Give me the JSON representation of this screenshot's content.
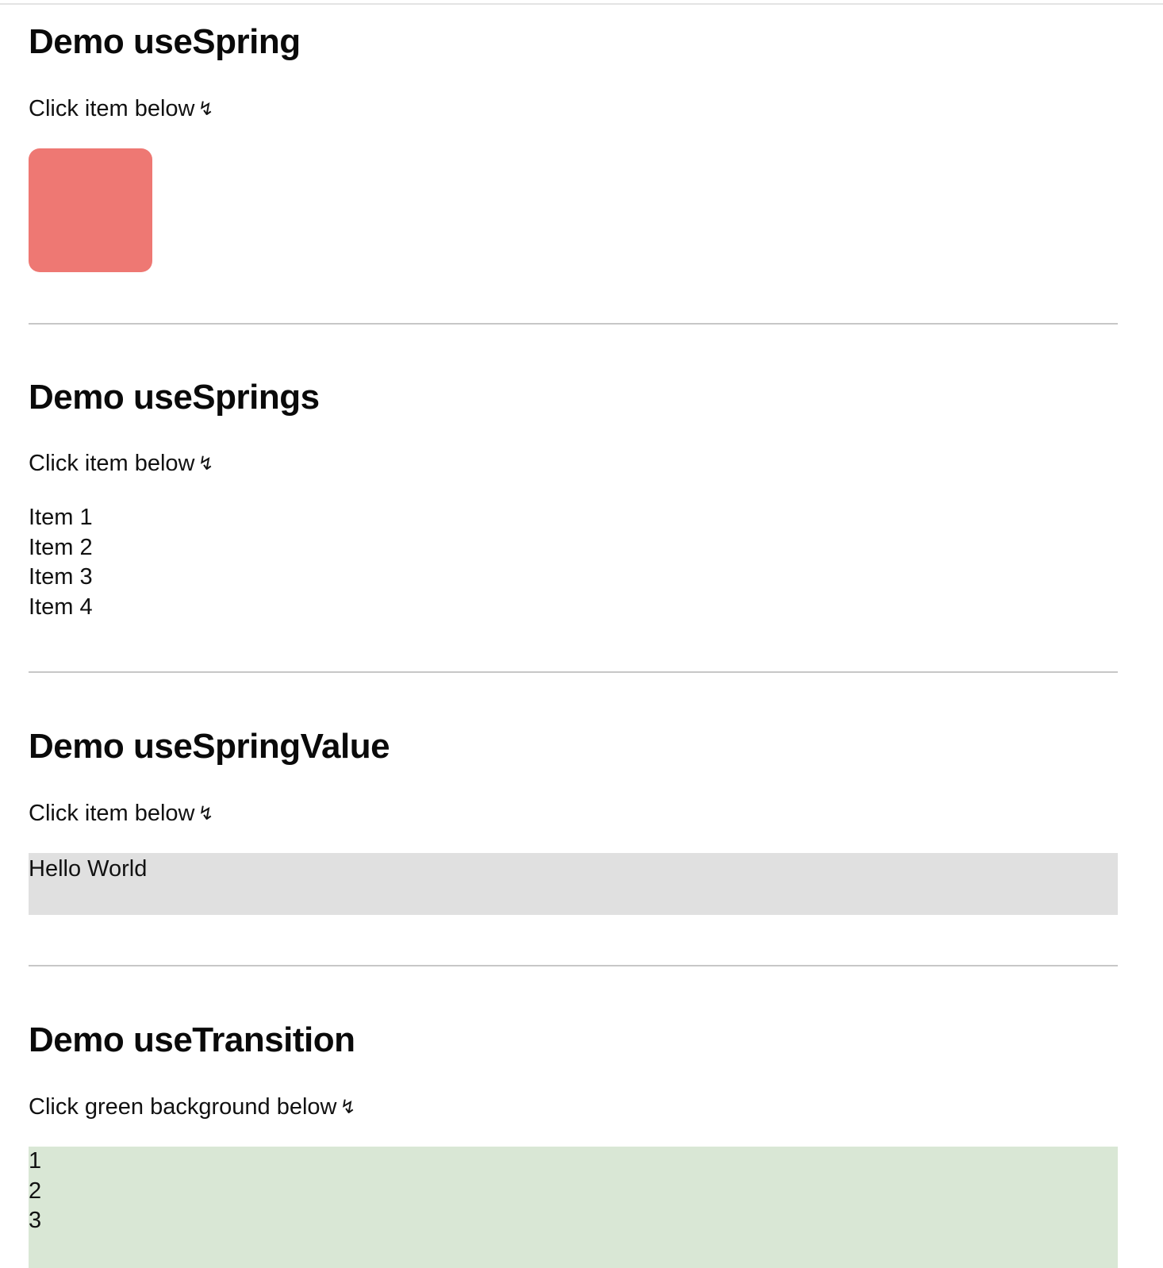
{
  "sections": {
    "use_spring": {
      "title": "Demo useSpring",
      "hint": "Click item below",
      "box_color": "#ee7873"
    },
    "use_springs": {
      "title": "Demo useSprings",
      "hint": "Click item below",
      "items": [
        "Item 1",
        "Item 2",
        "Item 3",
        "Item 4"
      ]
    },
    "use_spring_value": {
      "title": "Demo useSpringValue",
      "hint": "Click item below",
      "text": "Hello World",
      "background": "#e0e0e0"
    },
    "use_transition": {
      "title": "Demo useTransition",
      "hint": "Click green background below",
      "entries": [
        "1",
        "2",
        "3"
      ],
      "background": "#d9e7d5"
    }
  },
  "icons": {
    "hint_arrow": "down-arrow-icon",
    "hint_arrow_glyph": "↯"
  }
}
